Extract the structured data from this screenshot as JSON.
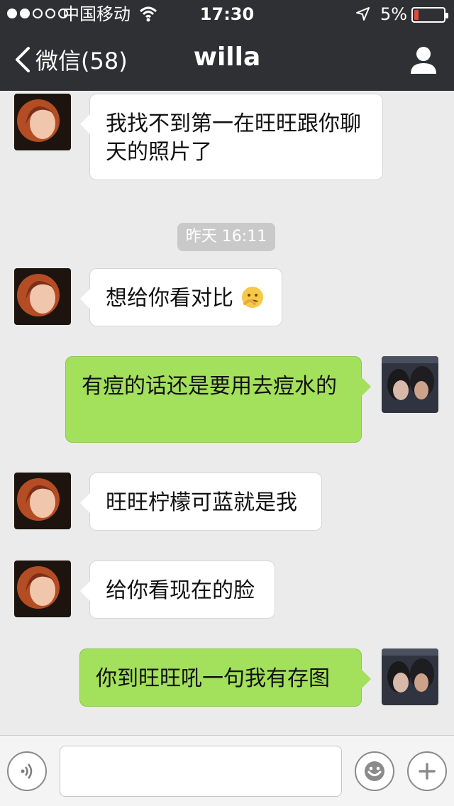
{
  "status_bar": {
    "carrier": "中国移动",
    "time": "17:30",
    "battery_percent": "5%",
    "battery_level": 0.05,
    "signal_total": 5,
    "signal_filled": 2
  },
  "nav": {
    "back_label": "微信(58)",
    "title": "willa",
    "back_icon": "chevron-left-icon",
    "profile_icon": "person-icon"
  },
  "messages": [
    {
      "sender": "contact",
      "text": "我找不到第一在旺旺跟你聊天的照片了"
    },
    {
      "type": "timestamp",
      "text": "昨天 16:11"
    },
    {
      "sender": "contact",
      "text": "想给你看对比",
      "emoji": "thinking-face-emoji"
    },
    {
      "sender": "self",
      "text": "有痘的话还是要用去痘水的"
    },
    {
      "sender": "contact",
      "text": "旺旺柠檬可蓝就是我"
    },
    {
      "sender": "contact",
      "text": "给你看现在的脸"
    },
    {
      "sender": "self",
      "text": "你到旺旺吼一句我有存图"
    }
  ],
  "input": {
    "value": "",
    "placeholder": ""
  },
  "colors": {
    "nav_background": "#2f3033",
    "chat_background": "#ebebeb",
    "outgoing_bubble": "#a3e05c",
    "incoming_bubble": "#ffffff",
    "battery_low": "#e24b3c"
  }
}
